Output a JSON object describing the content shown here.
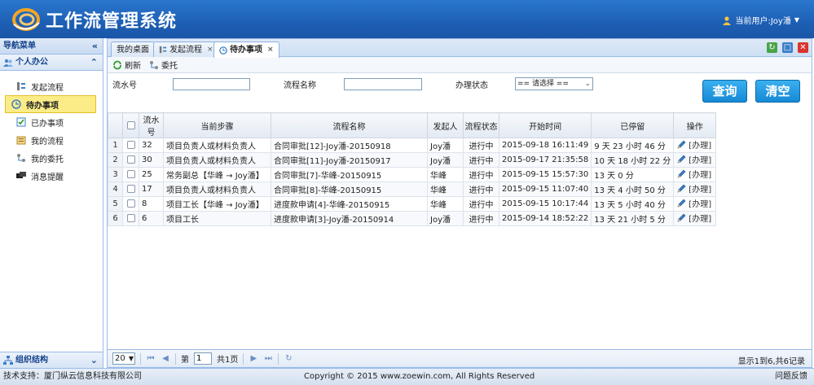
{
  "header": {
    "title": "工作流管理系统",
    "user_label": "当前用户:Joy潘",
    "dropdown_icon": "chevron-down-icon"
  },
  "sidebar": {
    "title": "导航菜单",
    "collapse_glyph": "«",
    "section": {
      "label": "个人办公",
      "toggle_glyph": "⌃"
    },
    "items": [
      {
        "label": "发起流程",
        "icon": "flow-start-icon"
      },
      {
        "label": "待办事项",
        "icon": "todo-icon",
        "active": true
      },
      {
        "label": "已办事项",
        "icon": "done-icon"
      },
      {
        "label": "我的流程",
        "icon": "my-flow-icon"
      },
      {
        "label": "我的委托",
        "icon": "delegate-icon"
      },
      {
        "label": "消息提醒",
        "icon": "message-icon"
      }
    ],
    "bottom_section": {
      "label": "组织结构",
      "toggle_glyph": "⌄"
    }
  },
  "tabs": [
    {
      "label": "我的桌面",
      "closable": false
    },
    {
      "label": "发起流程",
      "closable": true
    },
    {
      "label": "待办事项",
      "closable": true,
      "active": true
    }
  ],
  "tab_close_glyph": "×",
  "toolbar": {
    "refresh": "刷新",
    "delegate": "委托"
  },
  "filter": {
    "serial_label": "流水号",
    "serial_value": "",
    "name_label": "流程名称",
    "name_value": "",
    "status_label": "办理状态",
    "status_selected": "== 请选择 ==",
    "query_button": "查询",
    "clear_button": "清空"
  },
  "grid": {
    "columns": [
      "流水号",
      "当前步骤",
      "流程名称",
      "发起人",
      "流程状态",
      "开始时间",
      "已停留",
      "操作"
    ],
    "rows": [
      {
        "num": "1",
        "serial": "32",
        "step": "项目负责人或材料负责人",
        "name": "合同审批[12]-Joy潘-20150918",
        "initiator": "Joy潘",
        "status": "进行中",
        "start": "2015-09-18 16:11:49",
        "stay": "9 天 23 小时 46 分",
        "op": "[办理]"
      },
      {
        "num": "2",
        "serial": "30",
        "step": "项目负责人或材料负责人",
        "name": "合同审批[11]-Joy潘-20150917",
        "initiator": "Joy潘",
        "status": "进行中",
        "start": "2015-09-17 21:35:58",
        "stay": "10 天 18 小时 22 分",
        "op": "[办理]"
      },
      {
        "num": "3",
        "serial": "25",
        "step": "常务副总【华峰 → Joy潘】",
        "name": "合同审批[7]-华峰-20150915",
        "initiator": "华峰",
        "status": "进行中",
        "start": "2015-09-15 15:57:30",
        "stay": "13 天 0 分",
        "op": "[办理]"
      },
      {
        "num": "4",
        "serial": "17",
        "step": "项目负责人或材料负责人",
        "name": "合同审批[8]-华峰-20150915",
        "initiator": "华峰",
        "status": "进行中",
        "start": "2015-09-15 11:07:40",
        "stay": "13 天 4 小时 50 分",
        "op": "[办理]"
      },
      {
        "num": "5",
        "serial": "8",
        "step": "项目工长【华峰 → Joy潘】",
        "name": "进度款申请[4]-华峰-20150915",
        "initiator": "华峰",
        "status": "进行中",
        "start": "2015-09-15 10:17:44",
        "stay": "13 天 5 小时 40 分",
        "op": "[办理]"
      },
      {
        "num": "6",
        "serial": "6",
        "step": "项目工长",
        "name": "进度款申请[3]-Joy潘-20150914",
        "initiator": "Joy潘",
        "status": "进行中",
        "start": "2015-09-14 18:52:22",
        "stay": "13 天 21 小时 5 分",
        "op": "[办理]"
      }
    ]
  },
  "pager": {
    "page_size": "20",
    "page_prefix": "第",
    "current_page": "1",
    "page_suffix": "共1页",
    "info": "显示1到6,共6记录",
    "first_glyph": "⏮",
    "prev_glyph": "◀",
    "next_glyph": "▶",
    "last_glyph": "⏭",
    "refresh_glyph": "↻"
  },
  "footer": {
    "support": "技术支持：厦门纵云信息科技有限公司",
    "copyright": "Copyright © 2015 www.zoewin.com, All Rights Reserved",
    "feedback": "问题反馈"
  }
}
